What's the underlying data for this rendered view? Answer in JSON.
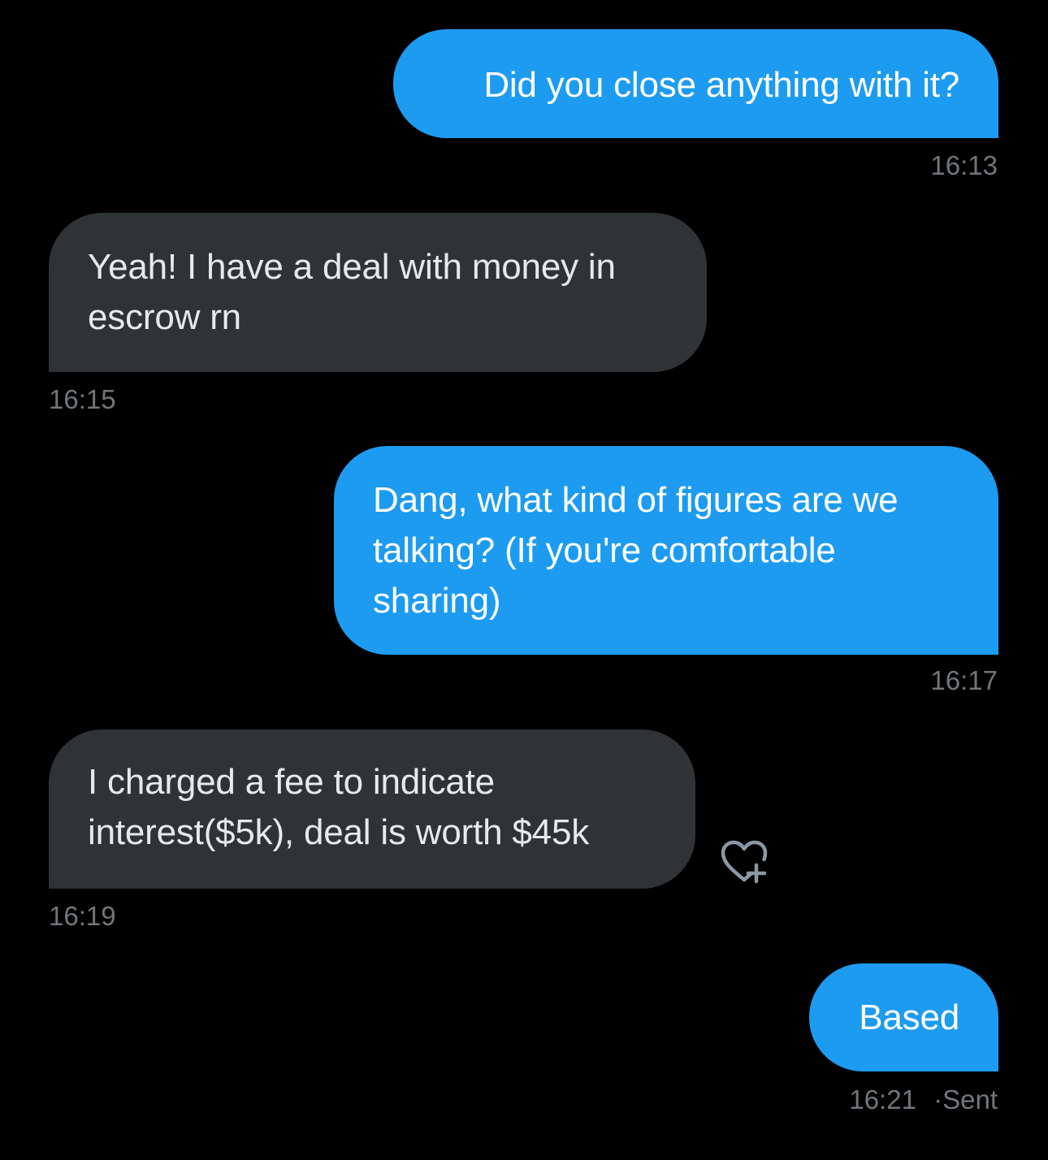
{
  "messages": [
    {
      "direction": "sent",
      "text": "Did you close anything with it?",
      "time": "16:13"
    },
    {
      "direction": "received",
      "text": "Yeah! I have a deal with money in escrow rn",
      "time": "16:15"
    },
    {
      "direction": "sent",
      "text": "Dang, what kind of figures are we talking? (If you're comfortable sharing)",
      "time": "16:17"
    },
    {
      "direction": "received",
      "text": "I charged a fee to indicate interest($5k), deal is worth $45k",
      "time": "16:19"
    },
    {
      "direction": "sent",
      "text": "Based",
      "time": "16:21",
      "status": "Sent"
    }
  ],
  "meta_separator": "·",
  "icons": {
    "react": "add-reaction-heart-icon"
  },
  "colors": {
    "background": "#000000",
    "sent_bubble": "#1d9bf0",
    "received_bubble": "#2f3336",
    "timestamp": "#71767b"
  }
}
